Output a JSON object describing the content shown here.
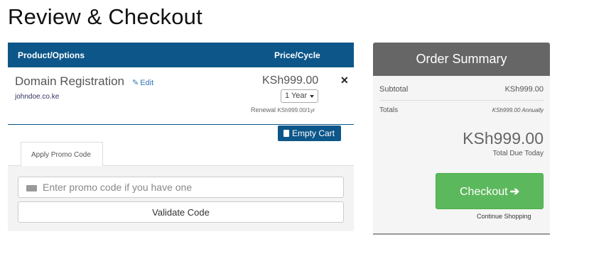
{
  "page": {
    "title": "Review & Checkout"
  },
  "cart": {
    "headers": {
      "product": "Product/Options",
      "price": "Price/Cycle"
    },
    "item": {
      "name": "Domain Registration",
      "edit_label": "Edit",
      "domain": "johndoe.co.ke",
      "price": "KSh999.00",
      "cycle": "1 Year",
      "renewal_label": "Renewal",
      "renewal_value": "KSh999.00/1yr"
    },
    "empty_cart_label": "Empty Cart"
  },
  "promo": {
    "tab_label": "Apply Promo Code",
    "placeholder": "Enter promo code if you have one",
    "validate_label": "Validate Code"
  },
  "summary": {
    "title": "Order Summary",
    "subtotal_label": "Subtotal",
    "subtotal_value": "KSh999.00",
    "totals_label": "Totals",
    "totals_value": "KSh999.00 Annually",
    "total_due": "KSh999.00",
    "total_due_label": "Total Due Today",
    "checkout_label": "Checkout",
    "continue_label": "Continue Shopping"
  },
  "colors": {
    "header_blue": "#0d5689",
    "checkout_green": "#5cb85c",
    "summary_head": "#666666"
  }
}
